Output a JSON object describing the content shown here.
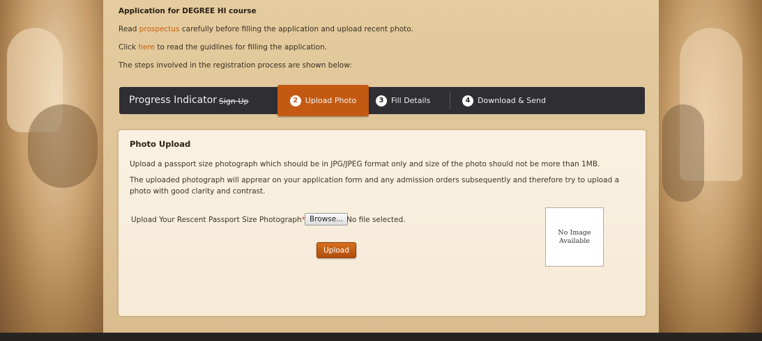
{
  "intro": {
    "heading": "Application for DEGREE HI course",
    "line1_pre": "Read ",
    "line1_link": "prospectus",
    "line1_post": " carefully before filling the application and upload recent photo.",
    "line2_pre": "Click ",
    "line2_link": "here",
    "line2_post": " to read the guidlines for filling the application.",
    "line3": "The steps involved in the registration process are shown below:"
  },
  "progress": {
    "label": "Progress Indicator",
    "signup": "Sign Up",
    "steps": [
      {
        "num": "2",
        "label": "Upload Photo",
        "active": true
      },
      {
        "num": "3",
        "label": "Fill Details",
        "active": false
      },
      {
        "num": "4",
        "label": "Download & Send",
        "active": false
      }
    ]
  },
  "panel": {
    "title": "Photo Upload",
    "para1": "Upload a passport size photograph which should be in JPG/JPEG format only and size of the photo should not be more than 1MB.",
    "para2": "The uploaded photograph will apprear on your application form and any admission orders subsequently and therefore try to upload a photo with good clarity and contrast.",
    "upload_label": "Upload Your Rescent Passport Size Photograph",
    "required_mark": "*",
    "browse_label": "Browse...",
    "file_status": "No file selected.",
    "upload_button": "Upload",
    "no_image": "No Image Available"
  },
  "colors": {
    "accent": "#c45a12",
    "link": "#c8610f",
    "progress_bar": "#2f2f33"
  }
}
